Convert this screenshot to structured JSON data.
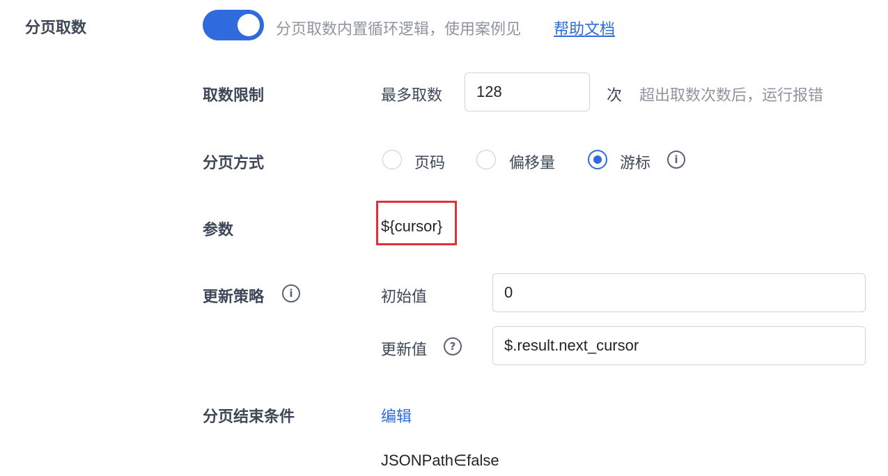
{
  "pagination": {
    "title": "分页取数",
    "toggle_on": true,
    "description": "分页取数内置循环逻辑，使用案例见",
    "help_link": "帮助文档"
  },
  "fetch_limit": {
    "label": "取数限制",
    "prefix": "最多取数",
    "value": "128",
    "unit": "次",
    "hint": "超出取数次数后，运行报错"
  },
  "paging_mode": {
    "label": "分页方式",
    "options": [
      "页码",
      "偏移量",
      "游标"
    ],
    "selected": "游标",
    "info_icon": "info-icon"
  },
  "params": {
    "label": "参数",
    "value": "${cursor}"
  },
  "update_strategy": {
    "label": "更新策略",
    "info_icon": "info-icon",
    "initial_label": "初始值",
    "initial_value": "0",
    "update_label": "更新值",
    "help_icon": "question-icon",
    "update_value": "$.result.next_cursor"
  },
  "end_condition": {
    "label": "分页结束条件",
    "edit_link": "编辑",
    "expression": "JSONPath∈false"
  },
  "colors": {
    "accent": "#2f6bdc",
    "highlight": "#e0313a"
  }
}
